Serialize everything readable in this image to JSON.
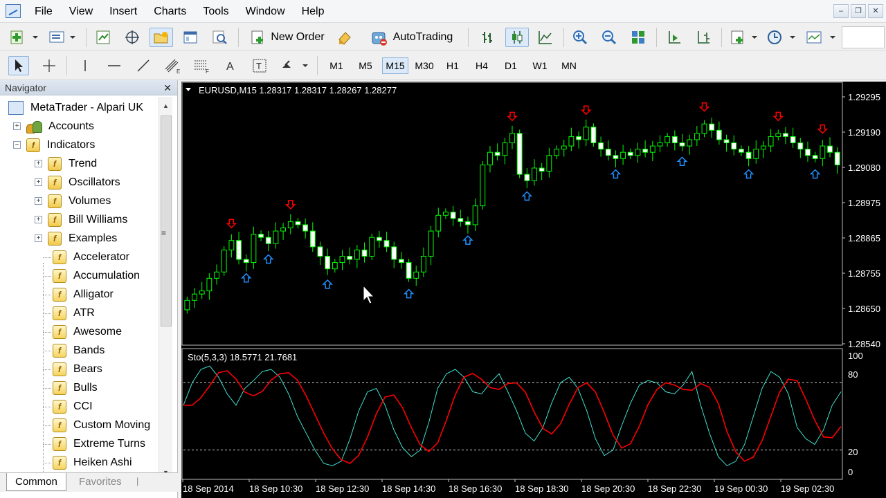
{
  "menu": [
    "File",
    "View",
    "Insert",
    "Charts",
    "Tools",
    "Window",
    "Help"
  ],
  "toolbar": {
    "new_order": "New Order",
    "autotrading": "AutoTrading"
  },
  "timeframes": [
    "M1",
    "M5",
    "M15",
    "M30",
    "H1",
    "H4",
    "D1",
    "W1",
    "MN"
  ],
  "active_timeframe": "M15",
  "navigator": {
    "title": "Navigator",
    "root": "MetaTrader - Alpari UK",
    "accounts": "Accounts",
    "indicators": "Indicators",
    "folders": [
      "Trend",
      "Oscillators",
      "Volumes",
      "Bill Williams",
      "Examples"
    ],
    "items": [
      "Accelerator",
      "Accumulation",
      "Alligator",
      "ATR",
      "Awesome",
      "Bands",
      "Bears",
      "Bulls",
      "CCI",
      "Custom Moving",
      "Extreme Turns",
      "Heiken Ashi"
    ],
    "tabs": [
      "Common",
      "Favorites"
    ]
  },
  "chart": {
    "header": "EURUSD,M15  1.28317 1.28317 1.28267 1.28277",
    "oscillator_label": "Sto(5,3,3) 18.5771 21.7681",
    "colors": {
      "bull_candle": "#00ff00",
      "bear_body": "#ffffff",
      "stoch_main": "#40e0d0",
      "stoch_signal": "#ff0000",
      "up_arrow": "#1e90ff",
      "down_arrow": "#ff0000"
    }
  },
  "chart_data": {
    "type": "candlestick",
    "price_axis_ticks": [
      "1.29295",
      "1.29190",
      "1.29080",
      "1.28975",
      "1.28865",
      "1.28755",
      "1.28650",
      "1.28540"
    ],
    "oscillator_axis_ticks": [
      "100",
      "80",
      "20",
      "0"
    ],
    "time_axis_labels": [
      "18 Sep 2014",
      "18 Sep 10:30",
      "18 Sep 12:30",
      "18 Sep 14:30",
      "18 Sep 16:30",
      "18 Sep 18:30",
      "18 Sep 20:30",
      "18 Sep 22:30",
      "19 Sep 00:30",
      "19 Sep 02:30"
    ],
    "ylim": [
      1.2851,
      1.2934
    ],
    "stoch_levels": [
      20,
      80
    ],
    "close": [
      1.2865,
      1.2867,
      1.2868,
      1.2872,
      1.2874,
      1.2881,
      1.2884,
      1.2878,
      1.2877,
      1.2886,
      1.2885,
      1.2883,
      1.2887,
      1.2888,
      1.289,
      1.2889,
      1.2887,
      1.2882,
      1.2879,
      1.2875,
      1.2877,
      1.2879,
      1.2878,
      1.2881,
      1.2879,
      1.2885,
      1.2884,
      1.2882,
      1.2878,
      1.2877,
      1.2872,
      1.2874,
      1.2879,
      1.2887,
      1.2892,
      1.2893,
      1.2891,
      1.289,
      1.2889,
      1.2895,
      1.2908,
      1.2912,
      1.2911,
      1.2915,
      1.2918,
      1.2905,
      1.2903,
      1.2907,
      1.2906,
      1.2911,
      1.2913,
      1.2914,
      1.2917,
      1.2916,
      1.292,
      1.2915,
      1.2913,
      1.2911,
      1.291,
      1.2912,
      1.2911,
      1.2913,
      1.2912,
      1.2914,
      1.2915,
      1.2917,
      1.2915,
      1.2914,
      1.2916,
      1.2918,
      1.2921,
      1.2919,
      1.2916,
      1.2915,
      1.2913,
      1.2912,
      1.291,
      1.2913,
      1.2914,
      1.2917,
      1.2918,
      1.2917,
      1.2915,
      1.2913,
      1.2911,
      1.291,
      1.2914,
      1.2912,
      1.2908
    ],
    "stoch_main": [
      60,
      80,
      92,
      95,
      85,
      70,
      60,
      75,
      82,
      90,
      92,
      85,
      70,
      50,
      35,
      20,
      8,
      6,
      10,
      30,
      55,
      72,
      75,
      60,
      38,
      22,
      14,
      20,
      45,
      75,
      88,
      92,
      85,
      72,
      70,
      80,
      88,
      72,
      55,
      35,
      28,
      40,
      62,
      80,
      85,
      75,
      55,
      30,
      15,
      20,
      42,
      62,
      78,
      82,
      80,
      72,
      70,
      78,
      90,
      60,
      35,
      14,
      6,
      10,
      25,
      50,
      75,
      90,
      85,
      70,
      40,
      30,
      25,
      38,
      60,
      72
    ]
  }
}
